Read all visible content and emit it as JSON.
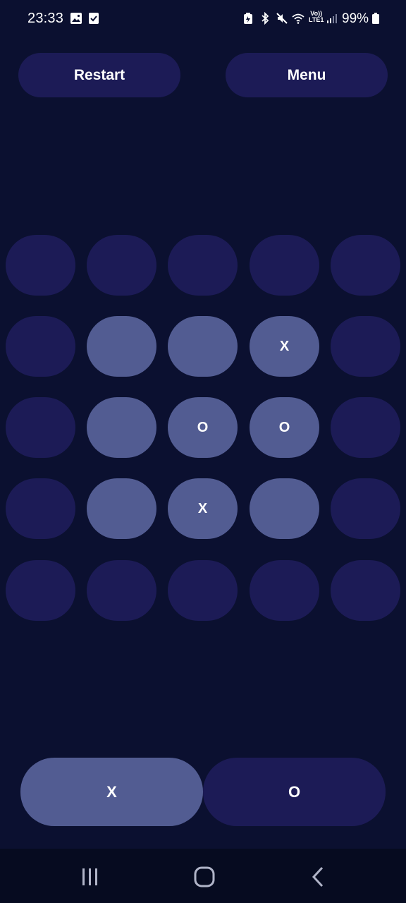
{
  "status_bar": {
    "time": "23:33",
    "lte_top": "Vo))",
    "lte_bottom": "LTE1",
    "battery": "99%",
    "icons": [
      "gallery-icon",
      "task-check-icon",
      "battery-saver-icon",
      "bluetooth-icon",
      "mute-icon",
      "wifi-icon",
      "signal-icon",
      "battery-icon"
    ]
  },
  "header": {
    "restart_label": "Restart",
    "menu_label": "Menu"
  },
  "board": {
    "rows": [
      [
        {
          "mark": "",
          "active": false
        },
        {
          "mark": "",
          "active": false
        },
        {
          "mark": "",
          "active": false
        },
        {
          "mark": "",
          "active": false
        },
        {
          "mark": "",
          "active": false
        }
      ],
      [
        {
          "mark": "",
          "active": false
        },
        {
          "mark": "",
          "active": true
        },
        {
          "mark": "",
          "active": true
        },
        {
          "mark": "X",
          "active": true
        },
        {
          "mark": "",
          "active": false
        }
      ],
      [
        {
          "mark": "",
          "active": false
        },
        {
          "mark": "",
          "active": true
        },
        {
          "mark": "O",
          "active": true
        },
        {
          "mark": "O",
          "active": true
        },
        {
          "mark": "",
          "active": false
        }
      ],
      [
        {
          "mark": "",
          "active": false
        },
        {
          "mark": "",
          "active": true
        },
        {
          "mark": "X",
          "active": true
        },
        {
          "mark": "",
          "active": true
        },
        {
          "mark": "",
          "active": false
        }
      ],
      [
        {
          "mark": "",
          "active": false
        },
        {
          "mark": "",
          "active": false
        },
        {
          "mark": "",
          "active": false
        },
        {
          "mark": "",
          "active": false
        },
        {
          "mark": "",
          "active": false
        }
      ]
    ]
  },
  "players": {
    "x_label": "X",
    "o_label": "O",
    "selected": "X"
  },
  "colors": {
    "background": "#0b1030",
    "button": "#1c1b56",
    "active_cell": "#525c92",
    "nav_bar": "#060b20"
  },
  "nav": {
    "icons": [
      "recent-apps-icon",
      "home-icon",
      "back-icon"
    ]
  }
}
